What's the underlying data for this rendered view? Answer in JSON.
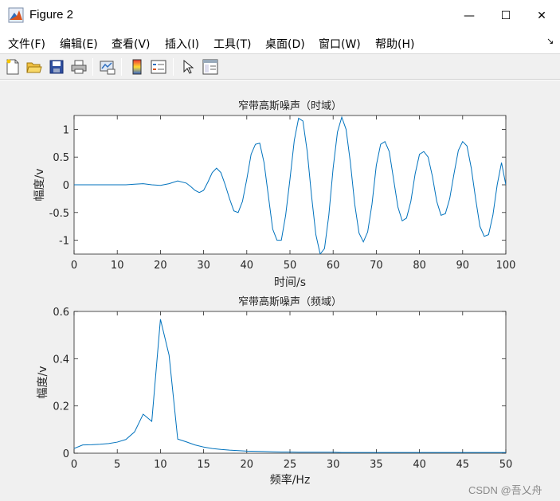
{
  "window": {
    "title": "Figure 2",
    "minimize_glyph": "—",
    "maximize_glyph": "☐",
    "close_glyph": "✕"
  },
  "menu": [
    {
      "label": "文件(F)"
    },
    {
      "label": "编辑(E)"
    },
    {
      "label": "查看(V)"
    },
    {
      "label": "插入(I)"
    },
    {
      "label": "工具(T)"
    },
    {
      "label": "桌面(D)"
    },
    {
      "label": "窗口(W)"
    },
    {
      "label": "帮助(H)"
    }
  ],
  "menu_dock_glyph": "↘",
  "toolbar": [
    {
      "name": "new-figure-icon"
    },
    {
      "name": "open-file-icon"
    },
    {
      "name": "save-icon"
    },
    {
      "name": "print-icon"
    },
    {
      "name": "link-plot-icon"
    },
    {
      "name": "insert-colorbar-icon"
    },
    {
      "name": "insert-legend-icon"
    },
    {
      "name": "edit-plot-icon"
    },
    {
      "name": "property-inspector-icon"
    }
  ],
  "watermark": "CSDN @吾乂舟",
  "chart_data": [
    {
      "type": "line",
      "title": "窄带高斯噪声（时域）",
      "xlabel": "时间/s",
      "ylabel": "幅度/v",
      "xlim": [
        0,
        100
      ],
      "ylim": [
        -1.25,
        1.25
      ],
      "xticks": [
        "0",
        "10",
        "20",
        "30",
        "40",
        "50",
        "60",
        "70",
        "80",
        "90",
        "100"
      ],
      "yticks": [
        "1",
        "0.5",
        "0",
        "-0.5",
        "-1"
      ],
      "ytick_values": [
        1,
        0.5,
        0,
        -0.5,
        -1
      ],
      "color": "#0072BD",
      "series": [
        {
          "x": [
            0,
            4,
            8,
            12,
            14,
            16,
            18,
            20,
            22,
            24,
            26,
            27,
            28,
            29,
            30,
            31,
            32,
            33,
            34,
            35,
            36,
            37,
            38,
            39,
            40,
            41,
            42,
            43,
            44,
            45,
            46,
            47,
            48,
            49,
            50,
            51,
            52,
            53,
            54,
            55,
            56,
            57,
            58,
            59,
            60,
            61,
            62,
            63,
            64,
            65,
            66,
            67,
            68,
            69,
            70,
            71,
            72,
            73,
            74,
            75,
            76,
            77,
            78,
            79,
            80,
            81,
            82,
            83,
            84,
            85,
            86,
            87,
            88,
            89,
            90,
            91,
            92,
            93,
            94,
            95,
            96,
            97,
            98,
            99,
            100
          ],
          "y": [
            0,
            0,
            0,
            0,
            0.01,
            0.02,
            0.0,
            -0.01,
            0.02,
            0.07,
            0.03,
            -0.03,
            -0.1,
            -0.14,
            -0.1,
            0.05,
            0.22,
            0.3,
            0.22,
            0.0,
            -0.25,
            -0.47,
            -0.5,
            -0.3,
            0.1,
            0.55,
            0.73,
            0.75,
            0.4,
            -0.2,
            -0.8,
            -1.0,
            -1.0,
            -0.55,
            0.1,
            0.8,
            1.2,
            1.15,
            0.6,
            -0.2,
            -0.9,
            -1.25,
            -1.15,
            -0.55,
            0.3,
            0.95,
            1.22,
            1.0,
            0.4,
            -0.35,
            -0.87,
            -1.03,
            -0.85,
            -0.35,
            0.35,
            0.73,
            0.78,
            0.6,
            0.1,
            -0.4,
            -0.65,
            -0.6,
            -0.3,
            0.2,
            0.55,
            0.6,
            0.5,
            0.15,
            -0.3,
            -0.55,
            -0.52,
            -0.25,
            0.2,
            0.62,
            0.78,
            0.7,
            0.3,
            -0.25,
            -0.75,
            -0.93,
            -0.9,
            -0.55,
            0.0,
            0.4,
            0.0
          ]
        }
      ]
    },
    {
      "type": "line",
      "title": "窄带高斯噪声（频域）",
      "xlabel": "频率/Hz",
      "ylabel": "幅度/v",
      "xlim": [
        0,
        50
      ],
      "ylim": [
        0,
        0.6
      ],
      "xticks": [
        "0",
        "5",
        "10",
        "15",
        "20",
        "25",
        "30",
        "35",
        "40",
        "45",
        "50"
      ],
      "yticks": [
        "0.6",
        "0.4",
        "0.2",
        "0"
      ],
      "ytick_values": [
        0.6,
        0.4,
        0.2,
        0
      ],
      "color": "#0072BD",
      "series": [
        {
          "x": [
            0,
            1,
            2,
            3,
            4,
            5,
            6,
            7,
            8,
            9,
            10,
            11,
            12,
            13,
            14,
            15,
            16,
            17,
            18,
            19,
            20,
            21,
            22,
            23,
            24,
            25,
            26,
            27,
            28,
            29,
            30,
            31,
            32,
            33,
            34,
            35,
            36,
            37,
            38,
            39,
            40,
            41,
            42,
            43,
            44,
            45,
            46,
            47,
            48,
            49,
            50
          ],
          "y": [
            0.02,
            0.035,
            0.036,
            0.038,
            0.041,
            0.047,
            0.058,
            0.09,
            0.165,
            0.135,
            0.567,
            0.415,
            0.06,
            0.048,
            0.035,
            0.026,
            0.02,
            0.016,
            0.013,
            0.011,
            0.009,
            0.008,
            0.007,
            0.006,
            0.005,
            0.005,
            0.004,
            0.004,
            0.004,
            0.004,
            0.004,
            0.003,
            0.003,
            0.003,
            0.003,
            0.003,
            0.003,
            0.003,
            0.003,
            0.003,
            0.003,
            0.003,
            0.003,
            0.003,
            0.003,
            0.003,
            0.003,
            0.003,
            0.003,
            0.003,
            0.003
          ]
        }
      ]
    }
  ]
}
